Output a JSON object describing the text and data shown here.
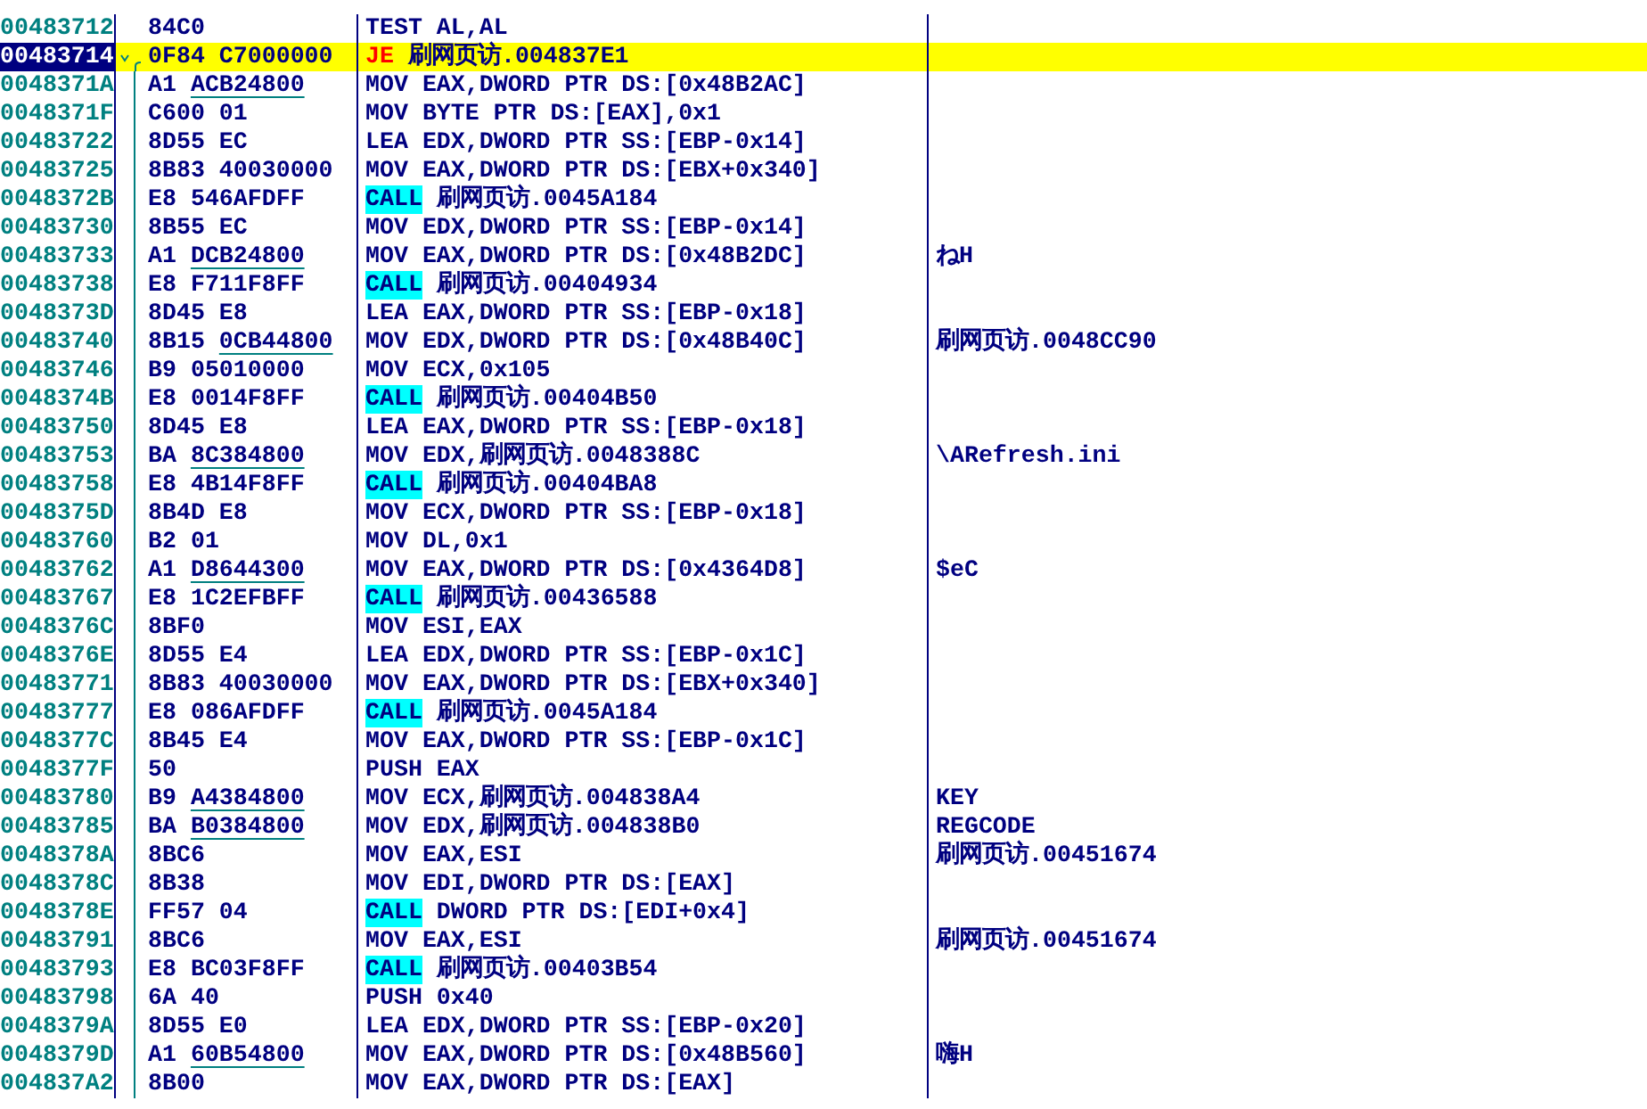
{
  "disassembly": {
    "rows": [
      {
        "address": "00483712",
        "opcode": "84C0",
        "kind": "plain",
        "mnemonic": "TEST",
        "operands": "AL,AL",
        "comment": "",
        "selected": false
      },
      {
        "address": "00483714",
        "opcode": "0F84",
        "operand_bytes": "C7000000",
        "fixup": false,
        "kind": "jump",
        "mnemonic": "JE",
        "operands": "刷网页访.004837E1",
        "comment": "",
        "selected": true
      },
      {
        "address": "0048371A",
        "opcode": "A1",
        "operand_bytes": "ACB24800",
        "fixup": true,
        "kind": "plain",
        "mnemonic": "MOV",
        "operands": "EAX,DWORD PTR DS:[0x48B2AC]",
        "comment": "",
        "selected": false
      },
      {
        "address": "0048371F",
        "opcode": "C600",
        "operand_bytes": "01",
        "fixup": false,
        "kind": "plain",
        "mnemonic": "MOV",
        "operands": "BYTE PTR DS:[EAX],0x1",
        "comment": "",
        "selected": false
      },
      {
        "address": "00483722",
        "opcode": "8D55",
        "operand_bytes": "EC",
        "fixup": false,
        "kind": "plain",
        "mnemonic": "LEA",
        "operands": "EDX,DWORD PTR SS:[EBP-0x14]",
        "comment": "",
        "selected": false
      },
      {
        "address": "00483725",
        "opcode": "8B83",
        "operand_bytes": "40030000",
        "fixup": false,
        "kind": "plain",
        "mnemonic": "MOV",
        "operands": "EAX,DWORD PTR DS:[EBX+0x340]",
        "comment": "",
        "selected": false
      },
      {
        "address": "0048372B",
        "opcode": "E8",
        "operand_bytes": "546AFDFF",
        "fixup": false,
        "kind": "call",
        "mnemonic": "CALL",
        "operands": "刷网页访.0045A184",
        "comment": "",
        "selected": false
      },
      {
        "address": "00483730",
        "opcode": "8B55",
        "operand_bytes": "EC",
        "fixup": false,
        "kind": "plain",
        "mnemonic": "MOV",
        "operands": "EDX,DWORD PTR SS:[EBP-0x14]",
        "comment": "",
        "selected": false
      },
      {
        "address": "00483733",
        "opcode": "A1",
        "operand_bytes": "DCB24800",
        "fixup": true,
        "kind": "plain",
        "mnemonic": "MOV",
        "operands": "EAX,DWORD PTR DS:[0x48B2DC]",
        "comment": "ねH",
        "selected": false
      },
      {
        "address": "00483738",
        "opcode": "E8",
        "operand_bytes": "F711F8FF",
        "fixup": false,
        "kind": "call",
        "mnemonic": "CALL",
        "operands": "刷网页访.00404934",
        "comment": "",
        "selected": false
      },
      {
        "address": "0048373D",
        "opcode": "8D45",
        "operand_bytes": "E8",
        "fixup": false,
        "kind": "plain",
        "mnemonic": "LEA",
        "operands": "EAX,DWORD PTR SS:[EBP-0x18]",
        "comment": "",
        "selected": false
      },
      {
        "address": "00483740",
        "opcode": "8B15",
        "operand_bytes": "0CB44800",
        "fixup": true,
        "kind": "plain",
        "mnemonic": "MOV",
        "operands": "EDX,DWORD PTR DS:[0x48B40C]",
        "comment": "刷网页访.0048CC90",
        "selected": false
      },
      {
        "address": "00483746",
        "opcode": "B9",
        "operand_bytes": "05010000",
        "fixup": false,
        "kind": "plain",
        "mnemonic": "MOV",
        "operands": "ECX,0x105",
        "comment": "",
        "selected": false
      },
      {
        "address": "0048374B",
        "opcode": "E8",
        "operand_bytes": "0014F8FF",
        "fixup": false,
        "kind": "call",
        "mnemonic": "CALL",
        "operands": "刷网页访.00404B50",
        "comment": "",
        "selected": false
      },
      {
        "address": "00483750",
        "opcode": "8D45",
        "operand_bytes": "E8",
        "fixup": false,
        "kind": "plain",
        "mnemonic": "LEA",
        "operands": "EAX,DWORD PTR SS:[EBP-0x18]",
        "comment": "",
        "selected": false
      },
      {
        "address": "00483753",
        "opcode": "BA",
        "operand_bytes": "8C384800",
        "fixup": true,
        "kind": "plain",
        "mnemonic": "MOV",
        "operands": "EDX,刷网页访.0048388C",
        "comment": "\\ARefresh.ini",
        "selected": false
      },
      {
        "address": "00483758",
        "opcode": "E8",
        "operand_bytes": "4B14F8FF",
        "fixup": false,
        "kind": "call",
        "mnemonic": "CALL",
        "operands": "刷网页访.00404BA8",
        "comment": "",
        "selected": false
      },
      {
        "address": "0048375D",
        "opcode": "8B4D",
        "operand_bytes": "E8",
        "fixup": false,
        "kind": "plain",
        "mnemonic": "MOV",
        "operands": "ECX,DWORD PTR SS:[EBP-0x18]",
        "comment": "",
        "selected": false
      },
      {
        "address": "00483760",
        "opcode": "B2",
        "operand_bytes": "01",
        "fixup": false,
        "kind": "plain",
        "mnemonic": "MOV",
        "operands": "DL,0x1",
        "comment": "",
        "selected": false
      },
      {
        "address": "00483762",
        "opcode": "A1",
        "operand_bytes": "D8644300",
        "fixup": true,
        "kind": "plain",
        "mnemonic": "MOV",
        "operands": "EAX,DWORD PTR DS:[0x4364D8]",
        "comment": "$eC",
        "selected": false
      },
      {
        "address": "00483767",
        "opcode": "E8",
        "operand_bytes": "1C2EFBFF",
        "fixup": false,
        "kind": "call",
        "mnemonic": "CALL",
        "operands": "刷网页访.00436588",
        "comment": "",
        "selected": false
      },
      {
        "address": "0048376C",
        "opcode": "8BF0",
        "kind": "plain",
        "mnemonic": "MOV",
        "operands": "ESI,EAX",
        "comment": "",
        "selected": false
      },
      {
        "address": "0048376E",
        "opcode": "8D55",
        "operand_bytes": "E4",
        "fixup": false,
        "kind": "plain",
        "mnemonic": "LEA",
        "operands": "EDX,DWORD PTR SS:[EBP-0x1C]",
        "comment": "",
        "selected": false
      },
      {
        "address": "00483771",
        "opcode": "8B83",
        "operand_bytes": "40030000",
        "fixup": false,
        "kind": "plain",
        "mnemonic": "MOV",
        "operands": "EAX,DWORD PTR DS:[EBX+0x340]",
        "comment": "",
        "selected": false
      },
      {
        "address": "00483777",
        "opcode": "E8",
        "operand_bytes": "086AFDFF",
        "fixup": false,
        "kind": "call",
        "mnemonic": "CALL",
        "operands": "刷网页访.0045A184",
        "comment": "",
        "selected": false
      },
      {
        "address": "0048377C",
        "opcode": "8B45",
        "operand_bytes": "E4",
        "fixup": false,
        "kind": "plain",
        "mnemonic": "MOV",
        "operands": "EAX,DWORD PTR SS:[EBP-0x1C]",
        "comment": "",
        "selected": false
      },
      {
        "address": "0048377F",
        "opcode": "50",
        "kind": "plain",
        "mnemonic": "PUSH",
        "operands": "EAX",
        "comment": "",
        "selected": false
      },
      {
        "address": "00483780",
        "opcode": "B9",
        "operand_bytes": "A4384800",
        "fixup": true,
        "kind": "plain",
        "mnemonic": "MOV",
        "operands": "ECX,刷网页访.004838A4",
        "comment": "KEY",
        "selected": false
      },
      {
        "address": "00483785",
        "opcode": "BA",
        "operand_bytes": "B0384800",
        "fixup": true,
        "kind": "plain",
        "mnemonic": "MOV",
        "operands": "EDX,刷网页访.004838B0",
        "comment": "REGCODE",
        "selected": false
      },
      {
        "address": "0048378A",
        "opcode": "8BC6",
        "kind": "plain",
        "mnemonic": "MOV",
        "operands": "EAX,ESI",
        "comment": "刷网页访.00451674",
        "selected": false
      },
      {
        "address": "0048378C",
        "opcode": "8B38",
        "kind": "plain",
        "mnemonic": "MOV",
        "operands": "EDI,DWORD PTR DS:[EAX]",
        "comment": "",
        "selected": false
      },
      {
        "address": "0048378E",
        "opcode": "FF57",
        "operand_bytes": "04",
        "fixup": false,
        "kind": "call",
        "mnemonic": "CALL",
        "operands": "DWORD PTR DS:[EDI+0x4]",
        "comment": "",
        "selected": false
      },
      {
        "address": "00483791",
        "opcode": "8BC6",
        "kind": "plain",
        "mnemonic": "MOV",
        "operands": "EAX,ESI",
        "comment": "刷网页访.00451674",
        "selected": false
      },
      {
        "address": "00483793",
        "opcode": "E8",
        "operand_bytes": "BC03F8FF",
        "fixup": false,
        "kind": "call",
        "mnemonic": "CALL",
        "operands": "刷网页访.00403B54",
        "comment": "",
        "selected": false
      },
      {
        "address": "00483798",
        "opcode": "6A",
        "operand_bytes": "40",
        "fixup": false,
        "kind": "plain",
        "mnemonic": "PUSH",
        "operands": "0x40",
        "comment": "",
        "selected": false
      },
      {
        "address": "0048379A",
        "opcode": "8D55",
        "operand_bytes": "E0",
        "fixup": false,
        "kind": "plain",
        "mnemonic": "LEA",
        "operands": "EDX,DWORD PTR SS:[EBP-0x20]",
        "comment": "",
        "selected": false
      },
      {
        "address": "0048379D",
        "opcode": "A1",
        "operand_bytes": "60B54800",
        "fixup": true,
        "kind": "plain",
        "mnemonic": "MOV",
        "operands": "EAX,DWORD PTR DS:[0x48B560]",
        "comment": "嗨H",
        "selected": false
      },
      {
        "address": "004837A2",
        "opcode": "8B00",
        "kind": "plain",
        "mnemonic": "MOV",
        "operands": "EAX,DWORD PTR DS:[EAX]",
        "comment": "",
        "selected": false
      }
    ]
  }
}
